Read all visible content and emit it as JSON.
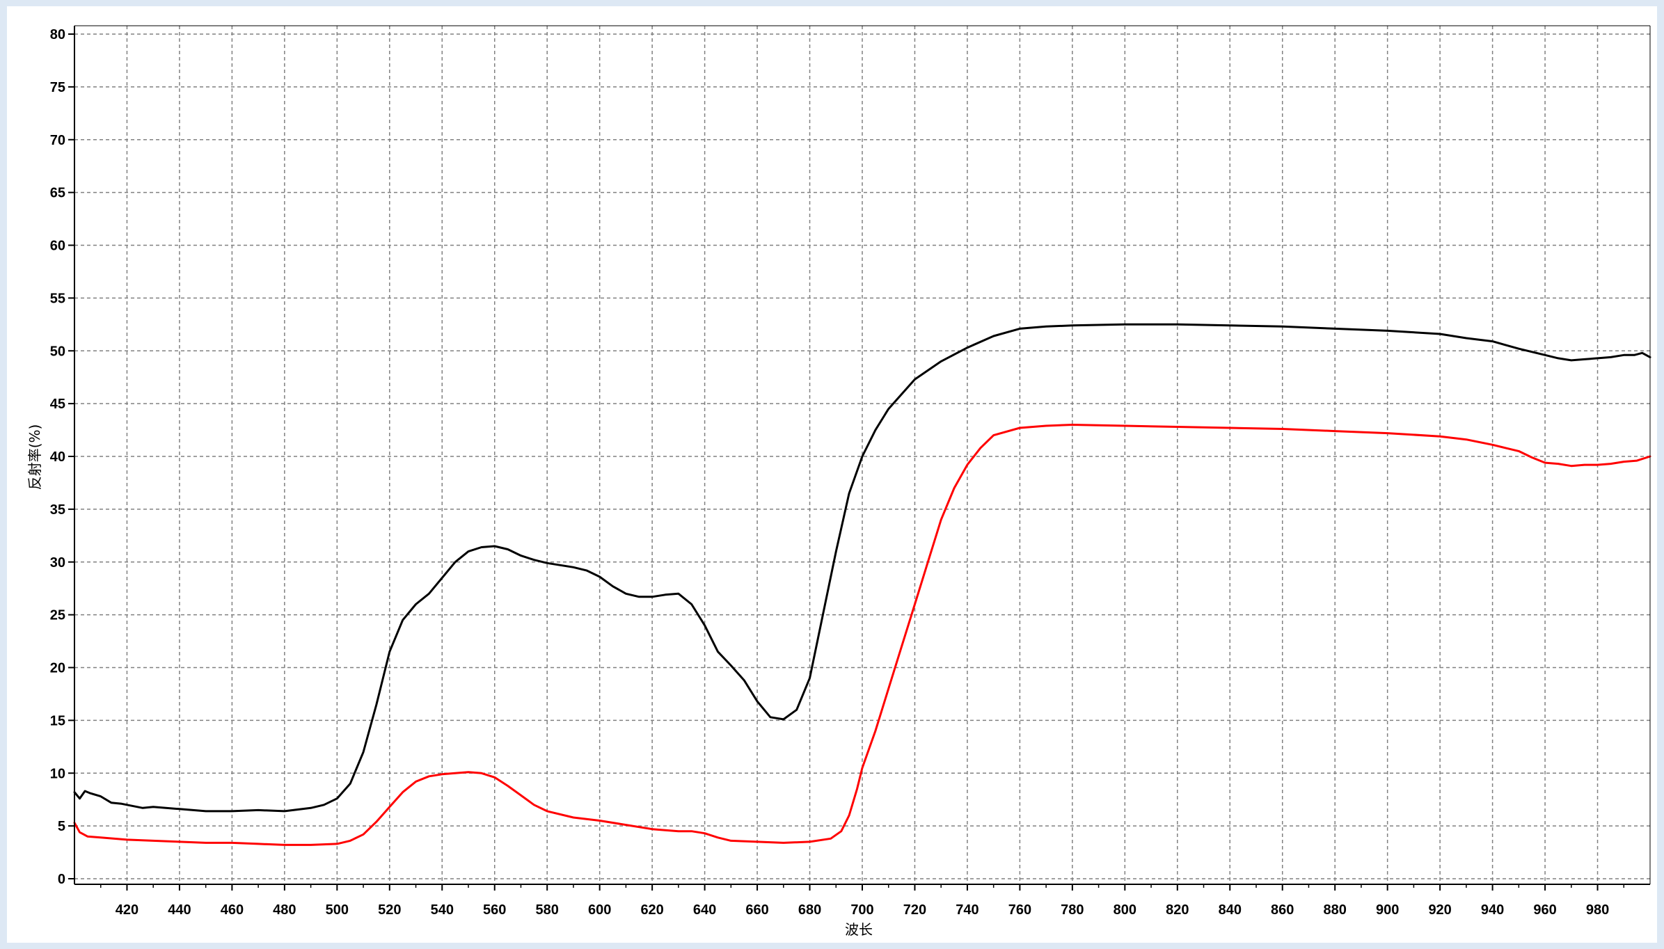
{
  "colors": {
    "window_bg": "#dde8f4",
    "plot_bg": "#ffffff",
    "grid": "#808080",
    "series_black": "#000000",
    "series_red": "#ff0000"
  },
  "chart_data": {
    "type": "line",
    "title": "",
    "xlabel": "波长",
    "ylabel": "反射率(%)",
    "xlim": [
      400,
      1000
    ],
    "ylim": [
      0,
      80
    ],
    "x_ticks": [
      420,
      440,
      460,
      480,
      500,
      520,
      540,
      560,
      580,
      600,
      620,
      640,
      660,
      680,
      700,
      720,
      740,
      760,
      780,
      800,
      820,
      840,
      860,
      880,
      900,
      920,
      940,
      960,
      980
    ],
    "y_ticks": [
      0,
      5,
      10,
      15,
      20,
      25,
      30,
      35,
      40,
      45,
      50,
      55,
      60,
      65,
      70,
      75,
      80
    ],
    "grid": true,
    "legend": "none",
    "series": [
      {
        "color": "#000000",
        "points": [
          [
            400,
            8.2
          ],
          [
            402,
            7.6
          ],
          [
            404,
            8.3
          ],
          [
            406,
            8.1
          ],
          [
            410,
            7.8
          ],
          [
            414,
            7.2
          ],
          [
            418,
            7.1
          ],
          [
            422,
            6.9
          ],
          [
            426,
            6.7
          ],
          [
            430,
            6.8
          ],
          [
            440,
            6.6
          ],
          [
            450,
            6.4
          ],
          [
            460,
            6.4
          ],
          [
            470,
            6.5
          ],
          [
            480,
            6.4
          ],
          [
            490,
            6.7
          ],
          [
            495,
            7.0
          ],
          [
            500,
            7.6
          ],
          [
            505,
            9.0
          ],
          [
            510,
            12.0
          ],
          [
            515,
            16.5
          ],
          [
            520,
            21.5
          ],
          [
            525,
            24.5
          ],
          [
            530,
            26.0
          ],
          [
            535,
            27.0
          ],
          [
            540,
            28.5
          ],
          [
            545,
            30.0
          ],
          [
            550,
            31.0
          ],
          [
            555,
            31.4
          ],
          [
            560,
            31.5
          ],
          [
            565,
            31.2
          ],
          [
            570,
            30.6
          ],
          [
            575,
            30.2
          ],
          [
            580,
            29.9
          ],
          [
            590,
            29.5
          ],
          [
            595,
            29.2
          ],
          [
            600,
            28.6
          ],
          [
            605,
            27.7
          ],
          [
            610,
            27.0
          ],
          [
            615,
            26.7
          ],
          [
            620,
            26.7
          ],
          [
            625,
            26.9
          ],
          [
            630,
            27.0
          ],
          [
            635,
            26.0
          ],
          [
            640,
            24.0
          ],
          [
            645,
            21.5
          ],
          [
            650,
            20.2
          ],
          [
            655,
            18.8
          ],
          [
            660,
            16.8
          ],
          [
            665,
            15.3
          ],
          [
            670,
            15.1
          ],
          [
            675,
            16.0
          ],
          [
            680,
            19.0
          ],
          [
            685,
            25.0
          ],
          [
            690,
            31.0
          ],
          [
            695,
            36.5
          ],
          [
            700,
            40.0
          ],
          [
            705,
            42.5
          ],
          [
            710,
            44.5
          ],
          [
            720,
            47.3
          ],
          [
            730,
            49.0
          ],
          [
            740,
            50.3
          ],
          [
            750,
            51.4
          ],
          [
            760,
            52.1
          ],
          [
            770,
            52.3
          ],
          [
            780,
            52.4
          ],
          [
            800,
            52.5
          ],
          [
            820,
            52.5
          ],
          [
            840,
            52.4
          ],
          [
            860,
            52.3
          ],
          [
            880,
            52.1
          ],
          [
            900,
            51.9
          ],
          [
            920,
            51.6
          ],
          [
            930,
            51.2
          ],
          [
            940,
            50.9
          ],
          [
            950,
            50.2
          ],
          [
            960,
            49.6
          ],
          [
            965,
            49.3
          ],
          [
            970,
            49.1
          ],
          [
            975,
            49.2
          ],
          [
            980,
            49.3
          ],
          [
            985,
            49.4
          ],
          [
            990,
            49.6
          ],
          [
            994,
            49.6
          ],
          [
            997,
            49.8
          ],
          [
            1000,
            49.4
          ]
        ]
      },
      {
        "color": "#ff0000",
        "points": [
          [
            400,
            5.3
          ],
          [
            402,
            4.4
          ],
          [
            405,
            4.0
          ],
          [
            410,
            3.9
          ],
          [
            420,
            3.7
          ],
          [
            430,
            3.6
          ],
          [
            440,
            3.5
          ],
          [
            450,
            3.4
          ],
          [
            460,
            3.4
          ],
          [
            470,
            3.3
          ],
          [
            480,
            3.2
          ],
          [
            490,
            3.2
          ],
          [
            500,
            3.3
          ],
          [
            505,
            3.6
          ],
          [
            510,
            4.2
          ],
          [
            515,
            5.4
          ],
          [
            520,
            6.8
          ],
          [
            525,
            8.2
          ],
          [
            530,
            9.2
          ],
          [
            535,
            9.7
          ],
          [
            540,
            9.9
          ],
          [
            545,
            10.0
          ],
          [
            550,
            10.1
          ],
          [
            555,
            10.0
          ],
          [
            560,
            9.6
          ],
          [
            565,
            8.8
          ],
          [
            570,
            7.9
          ],
          [
            575,
            7.0
          ],
          [
            580,
            6.4
          ],
          [
            590,
            5.8
          ],
          [
            600,
            5.5
          ],
          [
            610,
            5.1
          ],
          [
            620,
            4.7
          ],
          [
            630,
            4.5
          ],
          [
            635,
            4.5
          ],
          [
            640,
            4.3
          ],
          [
            645,
            3.9
          ],
          [
            650,
            3.6
          ],
          [
            660,
            3.5
          ],
          [
            670,
            3.4
          ],
          [
            680,
            3.5
          ],
          [
            688,
            3.8
          ],
          [
            692,
            4.5
          ],
          [
            695,
            6.0
          ],
          [
            698,
            8.5
          ],
          [
            700,
            10.5
          ],
          [
            705,
            14.0
          ],
          [
            710,
            18.0
          ],
          [
            715,
            22.0
          ],
          [
            720,
            26.0
          ],
          [
            725,
            30.0
          ],
          [
            730,
            34.0
          ],
          [
            735,
            37.0
          ],
          [
            740,
            39.2
          ],
          [
            745,
            40.8
          ],
          [
            750,
            42.0
          ],
          [
            760,
            42.7
          ],
          [
            770,
            42.9
          ],
          [
            780,
            43.0
          ],
          [
            800,
            42.9
          ],
          [
            820,
            42.8
          ],
          [
            840,
            42.7
          ],
          [
            860,
            42.6
          ],
          [
            880,
            42.4
          ],
          [
            900,
            42.2
          ],
          [
            920,
            41.9
          ],
          [
            930,
            41.6
          ],
          [
            940,
            41.1
          ],
          [
            945,
            40.8
          ],
          [
            950,
            40.5
          ],
          [
            955,
            39.9
          ],
          [
            960,
            39.4
          ],
          [
            965,
            39.3
          ],
          [
            970,
            39.1
          ],
          [
            975,
            39.2
          ],
          [
            980,
            39.2
          ],
          [
            985,
            39.3
          ],
          [
            990,
            39.5
          ],
          [
            995,
            39.6
          ],
          [
            1000,
            40.0
          ]
        ]
      }
    ]
  }
}
